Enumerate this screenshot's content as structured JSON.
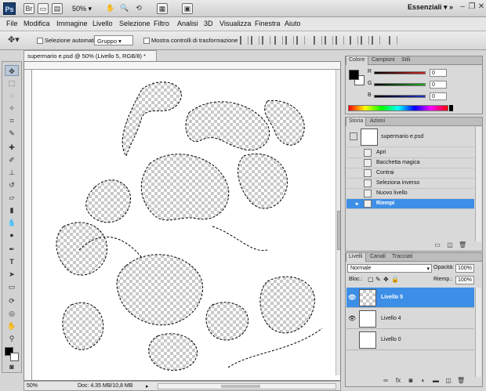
{
  "appbar": {
    "logo": "Ps",
    "zoom": "50%",
    "workspace": "Essenziali",
    "icons": [
      "bridge-icon",
      "minibridge-icon",
      "arrange-icon",
      "zoom-dropdown",
      "hand-icon",
      "zoom-icon",
      "rotate-icon",
      "arrange-docs-icon",
      "screen-mode-icon"
    ]
  },
  "menu": [
    "File",
    "Modifica",
    "Immagine",
    "Livello",
    "Selezione",
    "Filtro",
    "Analisi",
    "3D",
    "Visualizza",
    "Finestra",
    "Aiuto"
  ],
  "options": {
    "auto_select_label": "Selezione automatica:",
    "auto_select_value": "Gruppo",
    "show_transform_label": "Mostra controlli di trasformazione"
  },
  "document": {
    "tab_title": "supermario e.psd @ 50% (Livello 5, RGB/8) *",
    "tab_close": "×",
    "status_zoom": "50%",
    "status_doc": "Doc: 4.35 MB/10,8 MB"
  },
  "color_panel": {
    "tabs": [
      "Colore",
      "Campioni",
      "Stili"
    ],
    "channels": [
      {
        "label": "R",
        "value": "0",
        "color": "#cc2222"
      },
      {
        "label": "G",
        "value": "0",
        "color": "#22aa22"
      },
      {
        "label": "B",
        "value": "0",
        "color": "#2233cc"
      }
    ]
  },
  "history_panel": {
    "tabs": [
      "Storia",
      "Azioni"
    ],
    "snapshot": "supermario e.psd",
    "items": [
      "Apri",
      "Bacchetta magica",
      "Contrai",
      "Seleziona inverso",
      "Nuovo livello",
      "Riempi"
    ],
    "selected_index": 5
  },
  "layers_panel": {
    "tabs": [
      "Livelli",
      "Canali",
      "Tracciati"
    ],
    "blend_mode": "Normale",
    "opacity_label": "Opacità:",
    "opacity_value": "100%",
    "lock_label": "Bloc.:",
    "fill_label": "Riemp.:",
    "fill_value": "100%",
    "layers": [
      {
        "name": "Livello 5",
        "selected": true,
        "visible": true
      },
      {
        "name": "Livello 4",
        "selected": false,
        "visible": true
      },
      {
        "name": "Livello 0",
        "selected": false,
        "visible": false
      }
    ]
  }
}
